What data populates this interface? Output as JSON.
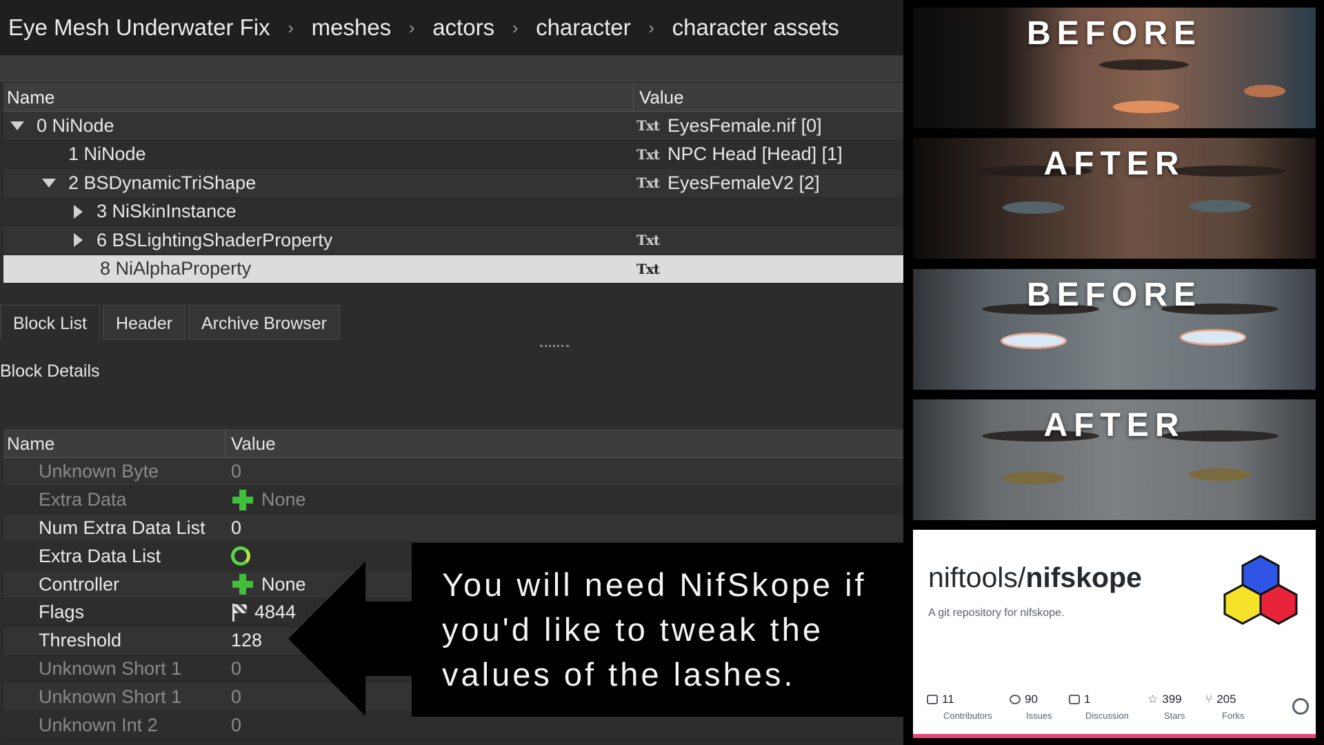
{
  "breadcrumb": [
    "Eye Mesh Underwater Fix",
    "meshes",
    "actors",
    "character",
    "character assets"
  ],
  "block_tree": {
    "columns": [
      "Name",
      "Value"
    ],
    "rows": [
      {
        "name": "0 NiNode",
        "value": "EyesFemale.nif [0]",
        "expander": "open",
        "indent": 0,
        "badge": "Txt"
      },
      {
        "name": "1 NiNode",
        "value": "NPC Head [Head] [1]",
        "expander": "none",
        "indent": 1,
        "badge": "Txt"
      },
      {
        "name": "2 BSDynamicTriShape",
        "value": "EyesFemaleV2 [2]",
        "expander": "open",
        "indent": 1,
        "badge": "Txt"
      },
      {
        "name": "3 NiSkinInstance",
        "value": "",
        "expander": "closed",
        "indent": 2,
        "badge": ""
      },
      {
        "name": "6 BSLightingShaderProperty",
        "value": "",
        "expander": "closed",
        "indent": 2,
        "badge": "Txt"
      },
      {
        "name": "8 NiAlphaProperty",
        "value": "",
        "expander": "none",
        "indent": 2,
        "badge": "Txt",
        "selected": true
      }
    ]
  },
  "tabs": [
    "Block List",
    "Header",
    "Archive Browser"
  ],
  "block_details_label": "Block Details",
  "details": {
    "columns": [
      "Name",
      "Value"
    ],
    "rows": [
      {
        "name": "Unknown Byte",
        "value": "0",
        "icon": "",
        "dim": true
      },
      {
        "name": "Extra Data",
        "value": "None",
        "icon": "plus-icon",
        "dim": true
      },
      {
        "name": "Num Extra Data List",
        "value": "0",
        "icon": "",
        "dim": false
      },
      {
        "name": "Extra Data List",
        "value": "",
        "icon": "refresh-icon",
        "dim": false
      },
      {
        "name": "Controller",
        "value": "None",
        "icon": "plus-icon",
        "dim": false
      },
      {
        "name": "Flags",
        "value": "4844",
        "icon": "flag-icon",
        "dim": false
      },
      {
        "name": "Threshold",
        "value": "128",
        "icon": "",
        "dim": false
      },
      {
        "name": "Unknown Short 1",
        "value": "0",
        "icon": "",
        "dim": true
      },
      {
        "name": "Unknown Short 1",
        "value": "0",
        "icon": "",
        "dim": true
      },
      {
        "name": "Unknown Int 2",
        "value": "0",
        "icon": "",
        "dim": true
      }
    ]
  },
  "callout": "You will need NifSkope if you'd like to tweak the values of the lashes.",
  "comparison_labels": [
    "BEFORE",
    "AFTER",
    "BEFORE",
    "AFTER"
  ],
  "github": {
    "owner": "niftools/",
    "repo": "nifskope",
    "description": "A git repository for nifskope.",
    "stats": [
      {
        "count": "11",
        "label": "Contributors",
        "icon": "people-icon"
      },
      {
        "count": "90",
        "label": "Issues",
        "icon": "issue-icon"
      },
      {
        "count": "1",
        "label": "Discussion",
        "icon": "discussion-icon"
      },
      {
        "count": "399",
        "label": "Stars",
        "icon": "star-icon"
      },
      {
        "count": "205",
        "label": "Forks",
        "icon": "fork-icon"
      }
    ]
  },
  "colors": {
    "selected_row": "#dcdcdc",
    "github_accent": "#e8457b",
    "green_icon": "#3fbf3a"
  }
}
